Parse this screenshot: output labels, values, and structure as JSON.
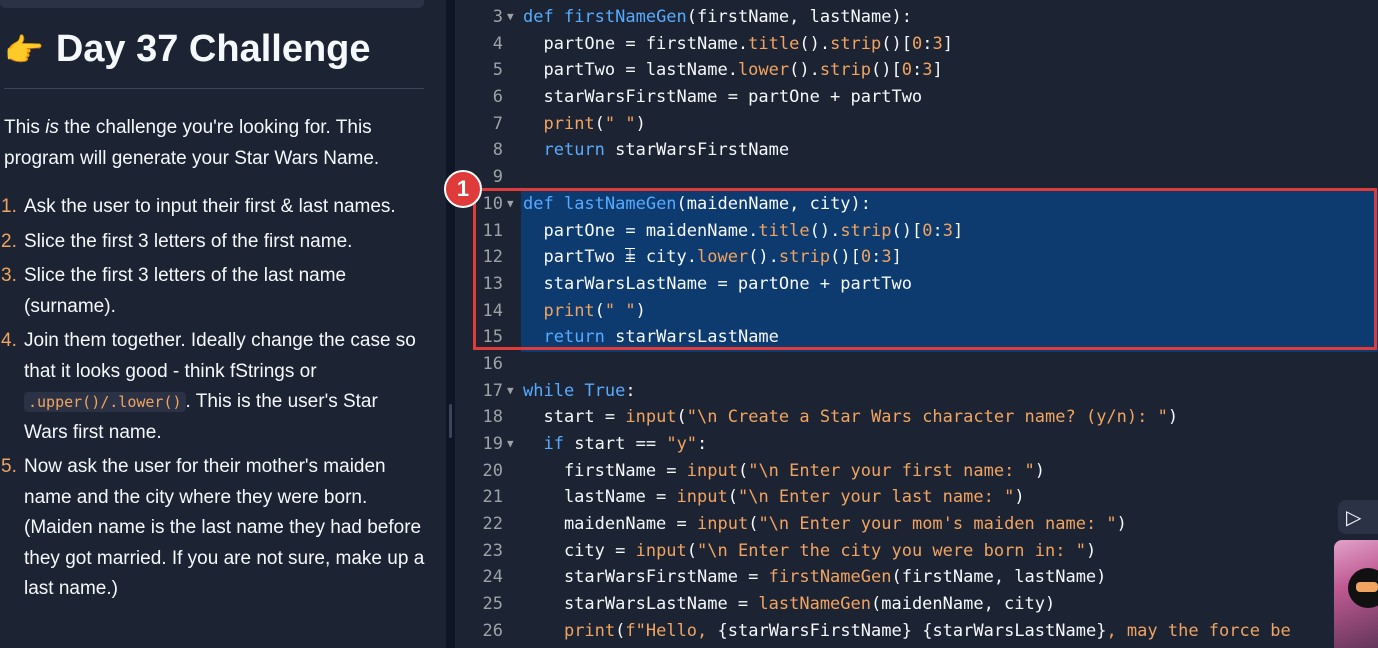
{
  "challenge": {
    "icon": "pointing-right-hand-icon",
    "title": "Day 37 Challenge",
    "intro_pre": "This ",
    "intro_em": "is",
    "intro_post": " the challenge you're looking for. This program will generate your Star Wars Name.",
    "steps": [
      {
        "num": "1.",
        "text": "Ask the user to input their first & last names."
      },
      {
        "num": "2.",
        "text": "Slice the first 3 letters of the first name."
      },
      {
        "num": "3.",
        "text": "Slice the first 3 letters of the last name (surname)."
      },
      {
        "num": "4.",
        "text_pre": "Join them together. Ideally change the case so that it looks good - think fStrings or ",
        "code": ".upper()/.lower()",
        "text_post": ". This is the user's Star Wars first name."
      },
      {
        "num": "5.",
        "text": "Now ask the user for their mother's maiden name and the city where they were born. (Maiden name is the last name they had before they got married. If you are not sure, make up a last name.)"
      }
    ]
  },
  "editor": {
    "highlight_badge": "1",
    "lines": [
      {
        "n": "3",
        "fold": true,
        "code": [
          [
            "kw",
            "def "
          ],
          [
            "fn",
            "firstNameGen"
          ],
          [
            "p",
            "(firstName, lastName):"
          ]
        ]
      },
      {
        "n": "4",
        "code": [
          [
            "p",
            "  partOne = firstName."
          ],
          [
            "mt",
            "title"
          ],
          [
            "p",
            "()."
          ],
          [
            "mt",
            "strip"
          ],
          [
            "p",
            "()["
          ],
          [
            "num",
            "0"
          ],
          [
            "p",
            ":"
          ],
          [
            "num",
            "3"
          ],
          [
            "p",
            "]"
          ]
        ]
      },
      {
        "n": "5",
        "code": [
          [
            "p",
            "  partTwo = lastName."
          ],
          [
            "mt",
            "lower"
          ],
          [
            "p",
            "()."
          ],
          [
            "mt",
            "strip"
          ],
          [
            "p",
            "()["
          ],
          [
            "num",
            "0"
          ],
          [
            "p",
            ":"
          ],
          [
            "num",
            "3"
          ],
          [
            "p",
            "]"
          ]
        ]
      },
      {
        "n": "6",
        "code": [
          [
            "p",
            "  starWarsFirstName = partOne + partTwo"
          ]
        ]
      },
      {
        "n": "7",
        "code": [
          [
            "p",
            "  "
          ],
          [
            "mt",
            "print"
          ],
          [
            "p",
            "("
          ],
          [
            "str",
            "\" \""
          ],
          [
            "p",
            ")"
          ]
        ]
      },
      {
        "n": "8",
        "code": [
          [
            "p",
            "  "
          ],
          [
            "kw",
            "return"
          ],
          [
            "p",
            " starWarsFirstName"
          ]
        ]
      },
      {
        "n": "9",
        "code": []
      },
      {
        "n": "10",
        "fold": true,
        "code": [
          [
            "kw",
            "def "
          ],
          [
            "fn",
            "lastNameGen"
          ],
          [
            "p",
            "(maidenName, city):"
          ]
        ]
      },
      {
        "n": "11",
        "code": [
          [
            "p",
            "  partOne = maidenName."
          ],
          [
            "mt",
            "title"
          ],
          [
            "p",
            "()."
          ],
          [
            "mt",
            "strip"
          ],
          [
            "p",
            "()["
          ],
          [
            "num",
            "0"
          ],
          [
            "p",
            ":"
          ],
          [
            "num",
            "3"
          ],
          [
            "p",
            "]"
          ]
        ]
      },
      {
        "n": "12",
        "code": [
          [
            "p",
            "  partTwo = city."
          ],
          [
            "mt",
            "lower"
          ],
          [
            "p",
            "()."
          ],
          [
            "mt",
            "strip"
          ],
          [
            "p",
            "()["
          ],
          [
            "num",
            "0"
          ],
          [
            "p",
            ":"
          ],
          [
            "num",
            "3"
          ],
          [
            "p",
            "]"
          ]
        ]
      },
      {
        "n": "13",
        "code": [
          [
            "p",
            "  starWarsLastName = partOne + partTwo"
          ]
        ]
      },
      {
        "n": "14",
        "code": [
          [
            "p",
            "  "
          ],
          [
            "mt",
            "print"
          ],
          [
            "p",
            "("
          ],
          [
            "str",
            "\" \""
          ],
          [
            "p",
            ")"
          ]
        ]
      },
      {
        "n": "15",
        "code": [
          [
            "p",
            "  "
          ],
          [
            "kw",
            "return"
          ],
          [
            "p",
            " starWarsLastName"
          ]
        ]
      },
      {
        "n": "16",
        "code": []
      },
      {
        "n": "17",
        "fold": true,
        "code": [
          [
            "kw",
            "while "
          ],
          [
            "kw",
            "True"
          ],
          [
            "p",
            ":"
          ]
        ]
      },
      {
        "n": "18",
        "code": [
          [
            "p",
            "  start = "
          ],
          [
            "mt",
            "input"
          ],
          [
            "p",
            "("
          ],
          [
            "str",
            "\"\\n Create a Star Wars character name? (y/n): \""
          ],
          [
            "p",
            ")"
          ]
        ]
      },
      {
        "n": "19",
        "fold": true,
        "code": [
          [
            "p",
            "  "
          ],
          [
            "kw",
            "if"
          ],
          [
            "p",
            " start == "
          ],
          [
            "str",
            "\"y\""
          ],
          [
            "p",
            ":"
          ]
        ]
      },
      {
        "n": "20",
        "code": [
          [
            "p",
            "    firstName = "
          ],
          [
            "mt",
            "input"
          ],
          [
            "p",
            "("
          ],
          [
            "str",
            "\"\\n Enter your first name: \""
          ],
          [
            "p",
            ")"
          ]
        ]
      },
      {
        "n": "21",
        "code": [
          [
            "p",
            "    lastName = "
          ],
          [
            "mt",
            "input"
          ],
          [
            "p",
            "("
          ],
          [
            "str",
            "\"\\n Enter your last name: \""
          ],
          [
            "p",
            ")"
          ]
        ]
      },
      {
        "n": "22",
        "code": [
          [
            "p",
            "    maidenName = "
          ],
          [
            "mt",
            "input"
          ],
          [
            "p",
            "("
          ],
          [
            "str",
            "\"\\n Enter your mom's maiden name: \""
          ],
          [
            "p",
            ")"
          ]
        ]
      },
      {
        "n": "23",
        "code": [
          [
            "p",
            "    city = "
          ],
          [
            "mt",
            "input"
          ],
          [
            "p",
            "("
          ],
          [
            "str",
            "\"\\n Enter the city you were born in: \""
          ],
          [
            "p",
            ")"
          ]
        ]
      },
      {
        "n": "24",
        "code": [
          [
            "p",
            "    starWarsFirstName = "
          ],
          [
            "mt",
            "firstNameGen"
          ],
          [
            "p",
            "(firstName, lastName)"
          ]
        ]
      },
      {
        "n": "25",
        "code": [
          [
            "p",
            "    starWarsLastName = "
          ],
          [
            "mt",
            "lastNameGen"
          ],
          [
            "p",
            "(maidenName, city)"
          ]
        ]
      },
      {
        "n": "26",
        "code": [
          [
            "p",
            "    "
          ],
          [
            "mt",
            "print"
          ],
          [
            "p",
            "("
          ],
          [
            "str",
            "f\"Hello, "
          ],
          [
            "p",
            "{starWarsFirstName} {starWarsLastName}"
          ],
          [
            "str",
            ", may the force be"
          ]
        ]
      }
    ]
  },
  "colors": {
    "keyword": "#57abff",
    "string": "#f0a460",
    "plain": "#f5f9fc",
    "selection": "#0d3a6f",
    "highlight_box": "#e03b3b"
  },
  "overlay": {
    "play_icon": "play-icon",
    "webcam": "webcam-thumbnail"
  }
}
